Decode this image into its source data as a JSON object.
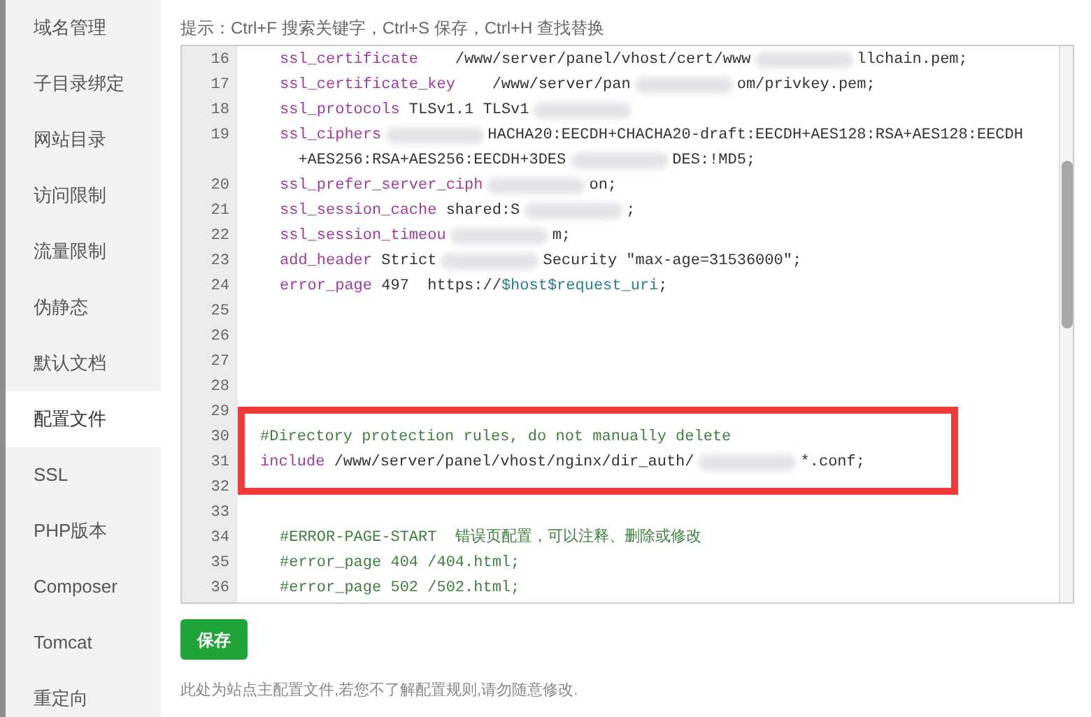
{
  "sidebar": {
    "items": [
      {
        "label": "域名管理",
        "selected": false
      },
      {
        "label": "子目录绑定",
        "selected": false
      },
      {
        "label": "网站目录",
        "selected": false
      },
      {
        "label": "访问限制",
        "selected": false
      },
      {
        "label": "流量限制",
        "selected": false
      },
      {
        "label": "伪静态",
        "selected": false
      },
      {
        "label": "默认文档",
        "selected": false
      },
      {
        "label": "配置文件",
        "selected": true
      },
      {
        "label": "SSL",
        "selected": false
      },
      {
        "label": "PHP版本",
        "selected": false
      },
      {
        "label": "Composer",
        "selected": false
      },
      {
        "label": "Tomcat",
        "selected": false
      },
      {
        "label": "重定向",
        "selected": false
      }
    ]
  },
  "hint": "提示：Ctrl+F 搜索关键字，Ctrl+S 保存，Ctrl+H 查找替换",
  "editor": {
    "lines": [
      {
        "number": "16",
        "indented": true,
        "segments": [
          {
            "kind": "keyword",
            "text": "ssl_certificate"
          },
          {
            "kind": "text",
            "text": "    /www/server/panel/vhost/cert/www"
          },
          {
            "kind": "redacted"
          },
          {
            "kind": "text",
            "text": "llchain.pem;"
          }
        ]
      },
      {
        "number": "17",
        "indented": true,
        "segments": [
          {
            "kind": "keyword",
            "text": "ssl_certificate_key"
          },
          {
            "kind": "text",
            "text": "    /www/server/pan"
          },
          {
            "kind": "redacted"
          },
          {
            "kind": "text",
            "text": "om/privkey.pem;"
          }
        ]
      },
      {
        "number": "18",
        "indented": true,
        "segments": [
          {
            "kind": "keyword",
            "text": "ssl_protocols"
          },
          {
            "kind": "text",
            "text": " TLSv1.1 TLSv1"
          },
          {
            "kind": "redacted"
          }
        ]
      },
      {
        "number": "19",
        "indented": true,
        "segments": [
          {
            "kind": "keyword",
            "text": "ssl_ciphers"
          },
          {
            "kind": "redacted"
          },
          {
            "kind": "text",
            "text": "HACHA20:EECDH+CHACHA20-draft:EECDH+AES128:RSA+AES128:EECDH"
          }
        ]
      },
      {
        "indented": true,
        "segments": [
          {
            "kind": "text",
            "text": "  +AES256:RSA+AES256:EECDH+3DES"
          },
          {
            "kind": "redacted"
          },
          {
            "kind": "text",
            "text": "DES:!MD5;"
          }
        ]
      },
      {
        "number": "20",
        "indented": true,
        "segments": [
          {
            "kind": "keyword",
            "text": "ssl_prefer_server_ciph"
          },
          {
            "kind": "redacted"
          },
          {
            "kind": "text",
            "text": "on;"
          }
        ]
      },
      {
        "number": "21",
        "indented": true,
        "segments": [
          {
            "kind": "keyword",
            "text": "ssl_session_cache"
          },
          {
            "kind": "text",
            "text": " shared:S"
          },
          {
            "kind": "redacted"
          },
          {
            "kind": "text",
            "text": ";"
          }
        ]
      },
      {
        "number": "22",
        "indented": true,
        "segments": [
          {
            "kind": "keyword",
            "text": "ssl_session_timeou"
          },
          {
            "kind": "redacted"
          },
          {
            "kind": "text",
            "text": "m;"
          }
        ]
      },
      {
        "number": "23",
        "indented": true,
        "segments": [
          {
            "kind": "keyword",
            "text": "add_header"
          },
          {
            "kind": "text",
            "text": " Strict"
          },
          {
            "kind": "redacted"
          },
          {
            "kind": "text",
            "text": "Security \"max-age=31536000\";"
          }
        ]
      },
      {
        "number": "24",
        "indented": true,
        "segments": [
          {
            "kind": "keyword",
            "text": "error_page"
          },
          {
            "kind": "text",
            "text": " 497  https://"
          },
          {
            "kind": "variable",
            "text": "$host$request_uri"
          },
          {
            "kind": "text",
            "text": ";"
          }
        ]
      },
      {
        "number": "25"
      },
      {
        "number": "26"
      },
      {
        "number": "27"
      },
      {
        "number": "28"
      },
      {
        "number": "29"
      },
      {
        "number": "30",
        "indented": false,
        "segments": [
          {
            "kind": "comment",
            "text": "#Directory protection rules, do not manually delete"
          }
        ]
      },
      {
        "number": "31",
        "indented": false,
        "segments": [
          {
            "kind": "keyword",
            "text": "include"
          },
          {
            "kind": "text",
            "text": " /www/server/panel/vhost/nginx/dir_auth/"
          },
          {
            "kind": "redacted"
          },
          {
            "kind": "text",
            "text": "*.conf;"
          }
        ]
      },
      {
        "number": "32"
      },
      {
        "number": "33"
      },
      {
        "number": "34",
        "indented": true,
        "segments": [
          {
            "kind": "comment",
            "text": "#ERROR-PAGE-START  错误页配置，可以注释、删除或修改"
          }
        ]
      },
      {
        "number": "35",
        "indented": true,
        "segments": [
          {
            "kind": "comment",
            "text": "#error_page 404 /404.html;"
          }
        ]
      },
      {
        "number": "36",
        "indented": true,
        "segments": [
          {
            "kind": "comment",
            "text": "#error_page 502 /502.html;"
          }
        ]
      }
    ]
  },
  "save_button": "保存",
  "footer_note": "此处为站点主配置文件,若您不了解配置规则,请勿随意修改."
}
